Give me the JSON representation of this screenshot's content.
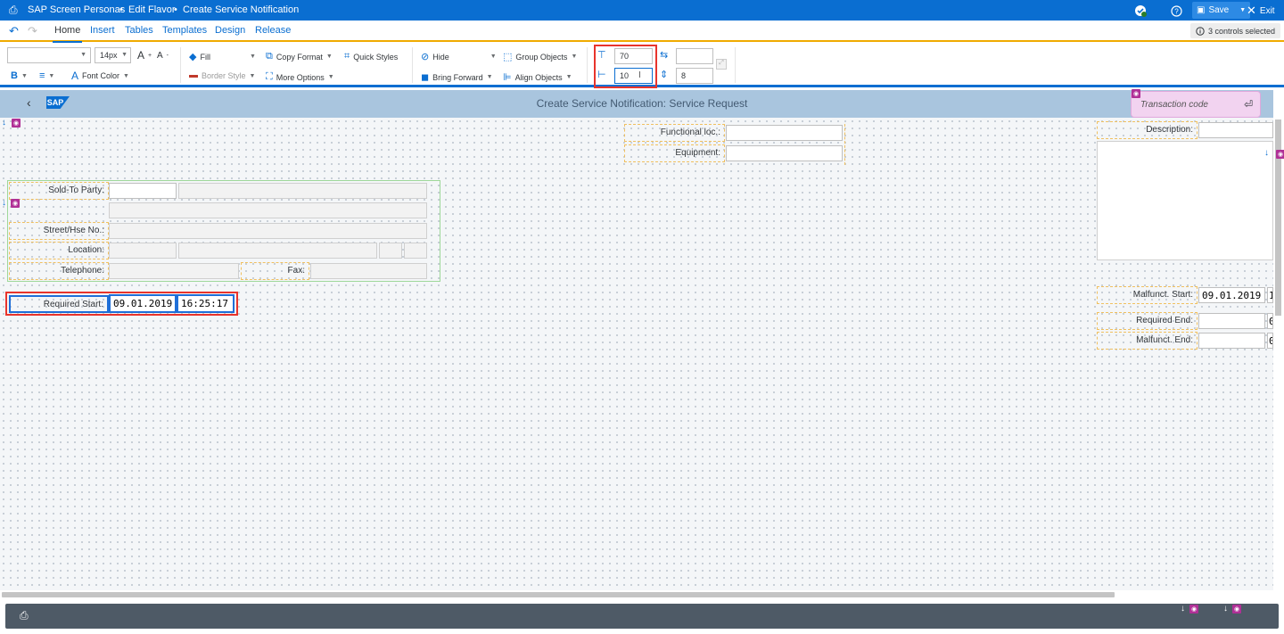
{
  "titlebar": {
    "app_name": "SAP Screen Personas",
    "mode": "Edit Flavor",
    "screen": "Create Service Notification",
    "save_label": "Save",
    "exit_label": "Exit"
  },
  "menu": {
    "tabs": [
      {
        "label": "Home",
        "active": true
      },
      {
        "label": "Insert"
      },
      {
        "label": "Tables"
      },
      {
        "label": "Templates"
      },
      {
        "label": "Design"
      },
      {
        "label": "Release"
      }
    ],
    "selection_status": "3 controls selected"
  },
  "ribbon": {
    "font_name": "",
    "font_size": "14px",
    "bold_label": "B",
    "font_color_label": "Font Color",
    "fill_label": "Fill",
    "border_style_label": "Border Style",
    "copy_format_label": "Copy Format",
    "more_options_label": "More Options",
    "quick_styles_label": "Quick Styles",
    "hide_label": "Hide",
    "bring_forward_label": "Bring Forward",
    "group_objects_label": "Group Objects",
    "align_objects_label": "Align Objects",
    "top_value": "70",
    "left_value": "10",
    "width_value": "",
    "height_value": "8"
  },
  "app": {
    "logo_text": "SAP",
    "title": "Create Service Notification: Service Request",
    "transaction_code_placeholder": "Transaction code"
  },
  "form": {
    "functional_loc_label": "Functional loc.:",
    "functional_loc_value": "",
    "equipment_label": "Equipment:",
    "equipment_value": "",
    "description_label": "Description:",
    "description_value": "",
    "sold_to_party_label": "Sold-To Party:",
    "sold_to_party_value": "",
    "street_label": "Street/Hse No.:",
    "location_label": "Location:",
    "telephone_label": "Telephone:",
    "fax_label": "Fax:",
    "required_start_label": "Required Start:",
    "required_start_date": "09.01.2019",
    "required_start_time": "16:25:17",
    "malfunct_start_label": "Malfunct. Start:",
    "malfunct_start_date": "09.01.2019",
    "malfunct_start_time_partial": "1",
    "required_end_label": "Required End:",
    "required_end_partial": "0",
    "malfunct_end_label": "Malfunct. End:",
    "malfunct_end_partial": "0"
  },
  "colors": {
    "shell_blue": "#0a6ed1",
    "header_bar": "#a9c5de",
    "selection_red": "#e8342c",
    "selection_blue": "#1f6fd8",
    "visibility_badge": "#b03096",
    "footer": "#4e5a66"
  }
}
